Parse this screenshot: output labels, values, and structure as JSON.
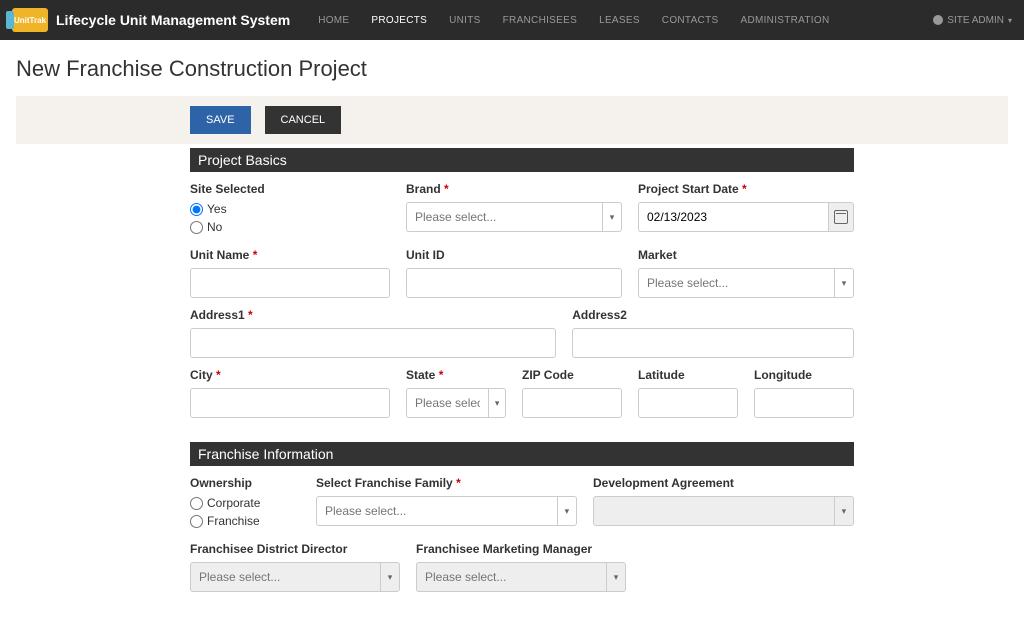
{
  "navbar": {
    "brand": "Lifecycle Unit Management System",
    "items": [
      "HOME",
      "PROJECTS",
      "UNITS",
      "FRANCHISEES",
      "LEASES",
      "CONTACTS",
      "ADMINISTRATION"
    ],
    "active_index": 1,
    "user_label": "SITE ADMIN"
  },
  "page": {
    "title": "New Franchise Construction Project",
    "save_label": "SAVE",
    "cancel_label": "CANCEL"
  },
  "sections": {
    "basics_header": "Project Basics",
    "franchise_header": "Franchise Information"
  },
  "fields": {
    "site_selected": {
      "label": "Site Selected",
      "yes": "Yes",
      "no": "No",
      "value": "Yes"
    },
    "brand": {
      "label": "Brand",
      "placeholder": "Please select..."
    },
    "start_date": {
      "label": "Project Start Date",
      "value": "02/13/2023"
    },
    "unit_name": {
      "label": "Unit Name"
    },
    "unit_id": {
      "label": "Unit ID"
    },
    "market": {
      "label": "Market",
      "placeholder": "Please select..."
    },
    "address1": {
      "label": "Address1"
    },
    "address2": {
      "label": "Address2"
    },
    "city": {
      "label": "City"
    },
    "state": {
      "label": "State",
      "placeholder": "Please select..."
    },
    "zip": {
      "label": "ZIP Code"
    },
    "latitude": {
      "label": "Latitude"
    },
    "longitude": {
      "label": "Longitude"
    },
    "ownership": {
      "label": "Ownership",
      "corporate": "Corporate",
      "franchise": "Franchise"
    },
    "franchise_family": {
      "label": "Select Franchise Family",
      "placeholder": "Please select..."
    },
    "dev_agreement": {
      "label": "Development Agreement"
    },
    "district_director": {
      "label": "Franchisee District Director",
      "placeholder": "Please select..."
    },
    "marketing_manager": {
      "label": "Franchisee Marketing Manager",
      "placeholder": "Please select..."
    }
  }
}
